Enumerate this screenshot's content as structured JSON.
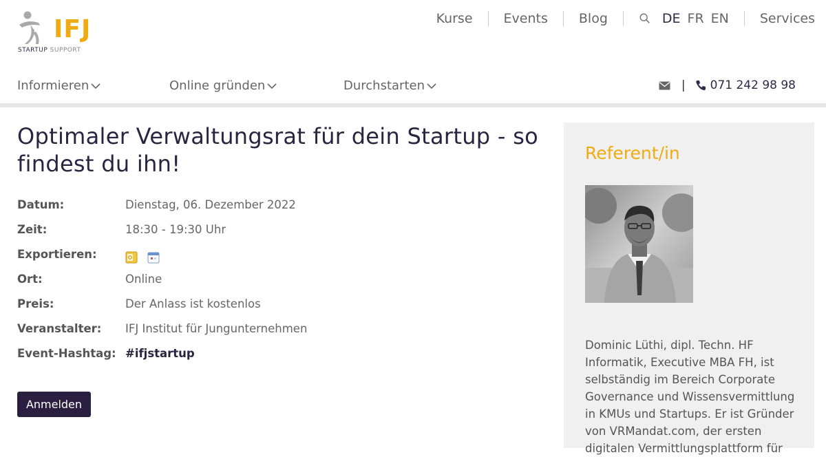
{
  "brand": {
    "logo_text": "IFJ",
    "tagline_bold": "STARTUP",
    "tagline_light": "SUPPORT"
  },
  "topnav": {
    "links": [
      "Kurse",
      "Events",
      "Blog"
    ],
    "languages": [
      "DE",
      "FR",
      "EN"
    ],
    "active_language": "DE",
    "services": "Services"
  },
  "mainnav": {
    "items": [
      "Informieren",
      "Online gründen",
      "Durchstarten"
    ]
  },
  "contact": {
    "separator": "|",
    "phone": "071 242 98 98"
  },
  "event": {
    "title": "Optimaler Verwaltungsrat für dein Startup - so findest du ihn!",
    "details": [
      {
        "label": "Datum:",
        "value": "Dienstag, 06. Dezember 2022"
      },
      {
        "label": "Zeit:",
        "value": "18:30 - 19:30 Uhr"
      },
      {
        "label": "Exportieren:",
        "value": ""
      },
      {
        "label": "Ort:",
        "value": "Online"
      },
      {
        "label": "Preis:",
        "value": "Der Anlass ist kostenlos"
      },
      {
        "label": "Veranstalter:",
        "value": "IFJ Institut für Jungunternehmen"
      },
      {
        "label": "Event-Hashtag:",
        "value": "#ifjstartup"
      }
    ],
    "register_button": "Anmelden"
  },
  "speaker": {
    "heading": "Referent/in",
    "bio": "Dominic Lüthi, dipl. Techn. HF Informatik, Executive MBA FH, ist selbständig im Bereich Corporate Governance und Wissensvermittlung in KMUs und Startups. Er ist Gründer von VRMandat.com, der ersten digitalen Vermittlungsplattform für"
  },
  "colors": {
    "accent": "#f0ab12",
    "dark": "#2a1f40",
    "sidebar_bg": "#f0f0f0"
  }
}
